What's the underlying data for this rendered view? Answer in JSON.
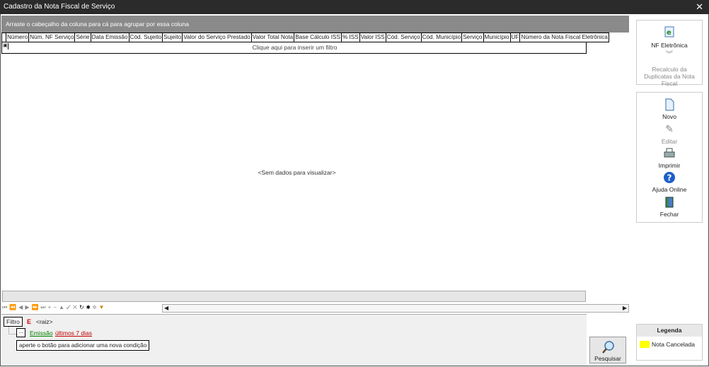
{
  "window": {
    "title": "Cadastro da Nota Fiscal de Serviço",
    "close": "✕"
  },
  "grid": {
    "group_hint": "Arraste o cabeçalho da coluna para cá para agrupar por essa coluna",
    "columns": [
      "Número",
      "Núm. NF Serviço",
      "Série",
      "Data Emissão",
      "Cód. Sujeito",
      "Sujeito",
      "Valor do Serviço Prestado",
      "Valor Total Nota",
      "Base Cálculo ISS",
      "% ISS",
      "Valor ISS",
      "Cód. Serviço",
      "Cód. Município",
      "Serviço",
      "Município",
      "UF",
      "Número da Nota Fiscal Eletrônica"
    ],
    "filter_row_text": "Clique aqui para inserir um filtro",
    "empty_text": "<Sem dados para visualizar>"
  },
  "filter": {
    "label": "Filtro",
    "operator": "E",
    "root": "<raiz>",
    "field": "Emissão",
    "condition": "últimos 7 dias",
    "add_button": "...",
    "tooltip": "aperte o botão para adicionar uma nova condição"
  },
  "actions": {
    "nf_eletronica": "NF Eletrônica",
    "recalculo": "Recalculo da Duplicatas da Nota Fiscal",
    "novo": "Novo",
    "editar": "Editar",
    "imprimir": "Imprimir",
    "ajuda": "Ajuda Online",
    "fechar": "Fechar",
    "pesquisar": "Pesquisar"
  },
  "legend": {
    "title": "Legenda",
    "items": [
      {
        "label": "Nota Cancelada",
        "color": "#ffff00"
      }
    ]
  }
}
